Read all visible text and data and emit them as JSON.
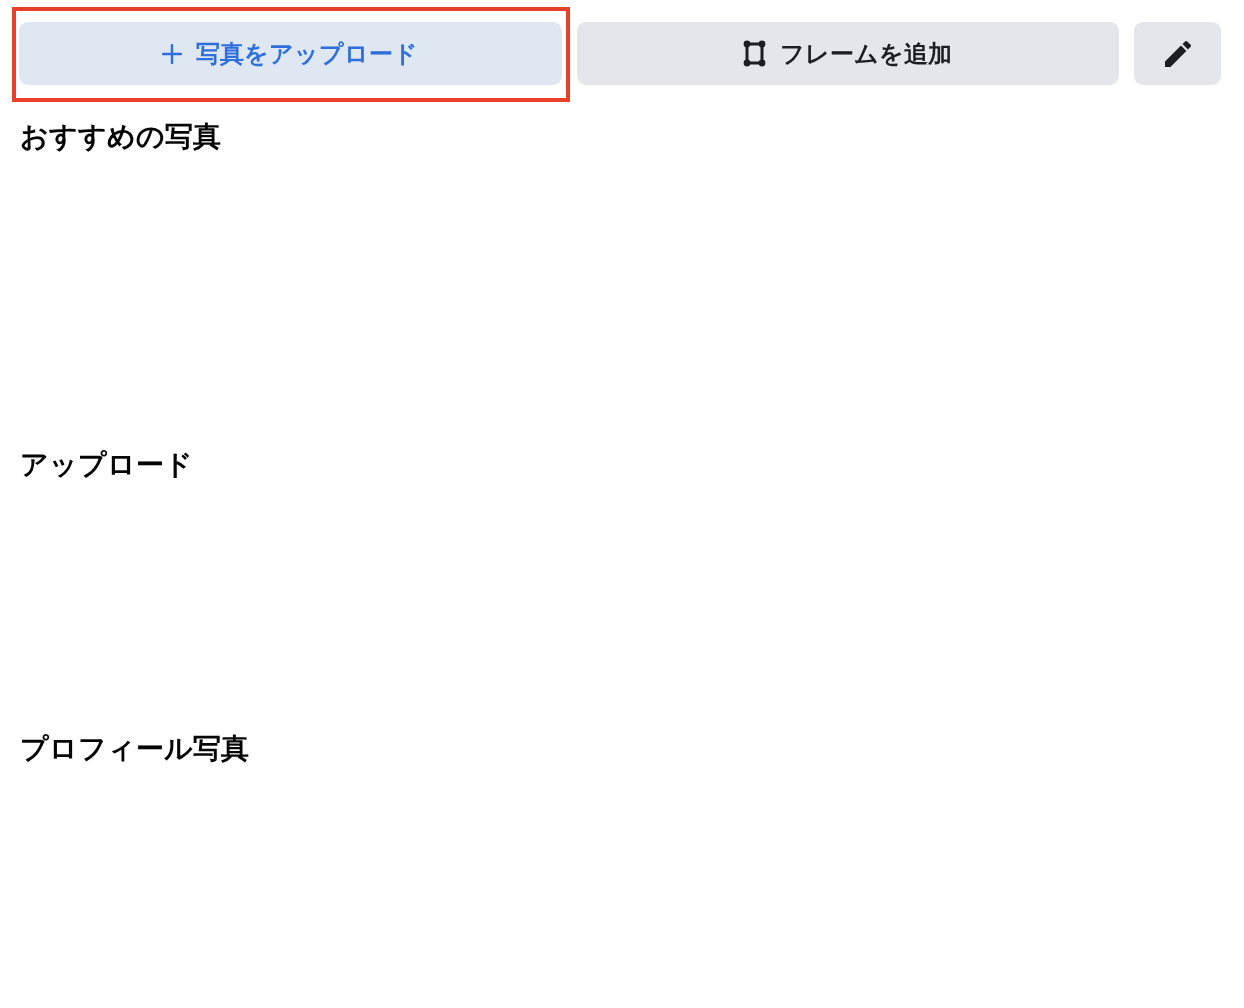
{
  "action_buttons": [
    {
      "kind": "upload",
      "label": "写真をアップロード",
      "highlighted": true
    },
    {
      "kind": "frame",
      "label": "フレームを追加",
      "highlighted": false
    },
    {
      "kind": "edit",
      "highlighted": false
    }
  ],
  "sections": [
    {
      "title": "おすすめの写真"
    },
    {
      "title": "アップロード"
    },
    {
      "title": "プロフィール写真"
    }
  ]
}
